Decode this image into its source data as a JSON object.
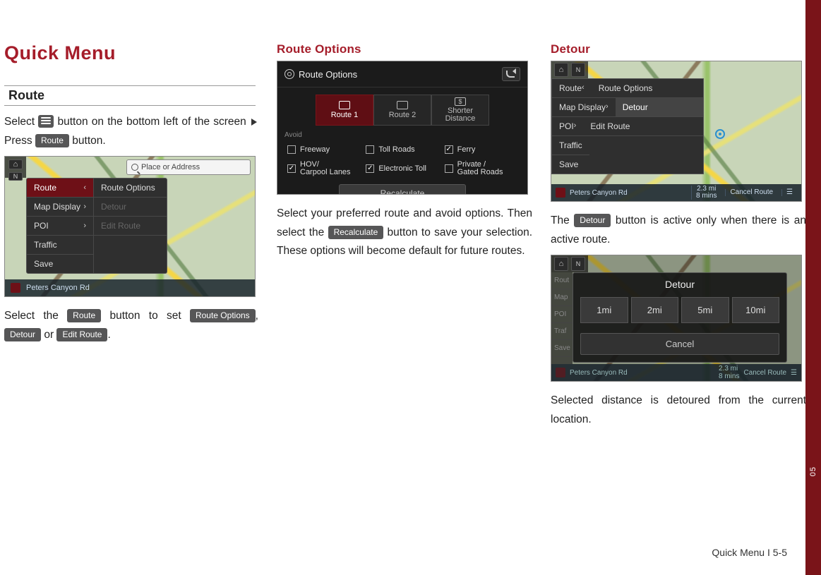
{
  "pageTitle": "Quick Menu",
  "footer": "Quick Menu I 5-5",
  "sideTab": "05",
  "col1": {
    "routeHeading": "Route",
    "p1_a": "Select ",
    "p1_b": " button on the bottom left of the screen ",
    "p1_c": " Press ",
    "routeBtn": "Route",
    "p1_d": " button.",
    "p2_a": "Select the ",
    "p2_b": " button to set ",
    "routeOptionsBtn": "Route Options",
    "p2_c": ", ",
    "detourBtn": "Detour",
    "p2_d": " or ",
    "editRouteBtn": "Edit Route",
    "p2_e": "."
  },
  "shot1": {
    "search": "Place or Address",
    "menuLeft": [
      "Route",
      "Map Display",
      "POI",
      "Traffic",
      "Save"
    ],
    "menuRight": [
      "Route Options",
      "Detour",
      "Edit Route"
    ],
    "bottomRoad": "Peters Canyon Rd"
  },
  "col2": {
    "heading": "Route Options",
    "p1_a": "Select your preferred route and avoid options. Then select the ",
    "recalcBtn": "Recalculate",
    "p1_b": " button to save your selection. These options will become default for future routes."
  },
  "shot2": {
    "title": "Route Options",
    "tabs": [
      "Route 1",
      "Route 2",
      "Shorter Distance"
    ],
    "avoidLabel": "Avoid",
    "checks": [
      {
        "label": "Freeway",
        "checked": false
      },
      {
        "label": "Toll Roads",
        "checked": false
      },
      {
        "label": "Ferry",
        "checked": true
      },
      {
        "label": "HOV/\nCarpool Lanes",
        "checked": true
      },
      {
        "label": "Electronic Toll",
        "checked": true
      },
      {
        "label": "Private /\nGated Roads",
        "checked": false
      }
    ],
    "recalc": "Recalculate"
  },
  "col3": {
    "heading": "Detour",
    "p1_a": "The ",
    "detourBtn": "Detour",
    "p1_b": " button is active only when there is an active route.",
    "p2": "Selected distance is detoured from the current location."
  },
  "shot3": {
    "menuLeft": [
      "Route",
      "Map Display",
      "POI",
      "Traffic",
      "Save"
    ],
    "menuRight": [
      "Route Options",
      "Detour",
      "Edit Route"
    ],
    "bottomRoad": "Peters Canyon Rd",
    "dist": "2.3 mi",
    "time": "8 mins",
    "cancel": "Cancel Route"
  },
  "shot4": {
    "title": "Detour",
    "options": [
      "1mi",
      "2mi",
      "5mi",
      "10mi"
    ],
    "cancel": "Cancel",
    "leftItems": [
      "Rout",
      "Map",
      "POI",
      "Traf",
      "Save"
    ],
    "bottomRoad": "Peters Canyon Rd",
    "dist": "2.3 mi",
    "time": "8 mins",
    "cancelRoute": "Cancel Route"
  }
}
